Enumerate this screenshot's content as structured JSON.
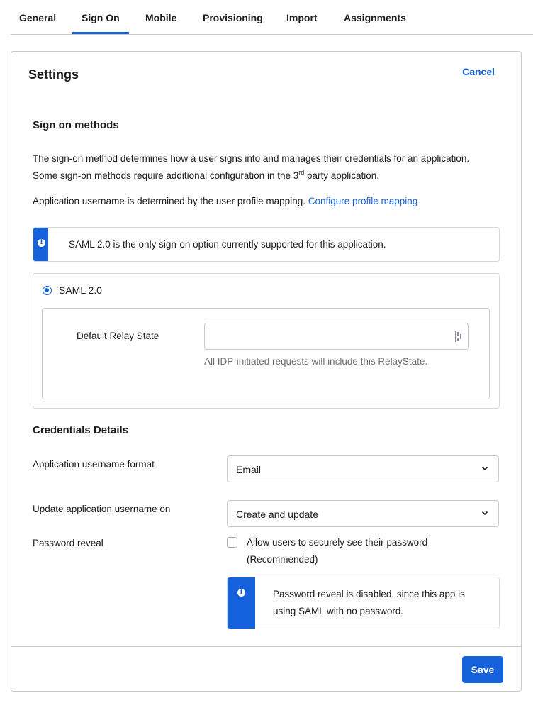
{
  "tabs": [
    {
      "label": "General",
      "active": false
    },
    {
      "label": "Sign On",
      "active": true
    },
    {
      "label": "Mobile",
      "active": false
    },
    {
      "label": "Provisioning",
      "active": false
    },
    {
      "label": "Import",
      "active": false
    },
    {
      "label": "Assignments",
      "active": false
    }
  ],
  "settings": {
    "title": "Settings",
    "cancel_label": "Cancel",
    "save_label": "Save"
  },
  "sign_on_methods": {
    "heading": "Sign on methods",
    "description_part1": "The sign-on method determines how a user signs into and manages their credentials for an application. Some sign-on methods require additional configuration in the 3",
    "description_sup": "rd",
    "description_part2": " party application.",
    "mapping_text": "Application username is determined by the user profile mapping. ",
    "mapping_link": "Configure profile mapping",
    "info_callout": "SAML 2.0 is the only sign-on option currently supported for this application.",
    "option_label": "SAML 2.0",
    "option_selected": true,
    "relay_state": {
      "label": "Default Relay State",
      "value": "",
      "placeholder": "",
      "helper": "All IDP-initiated requests will include this RelayState."
    }
  },
  "credentials": {
    "heading": "Credentials Details",
    "username_format": {
      "label": "Application username format",
      "value": "Email"
    },
    "update_on": {
      "label": "Update application username on",
      "value": "Create and update"
    },
    "password_reveal": {
      "label": "Password reveal",
      "checkbox_label": "Allow users to securely see their password (Recommended)",
      "checked": false,
      "info_callout": "Password reveal is disabled, since this app is using SAML with no password."
    }
  },
  "colors": {
    "accent": "#1662dd",
    "border": "#c8c8cc",
    "text": "#1d1d21",
    "muted_text": "#6e6e78"
  },
  "icons": {
    "info": "info-icon",
    "chevron": "chevron-down-icon",
    "password_manager": "password-manager-icon"
  }
}
